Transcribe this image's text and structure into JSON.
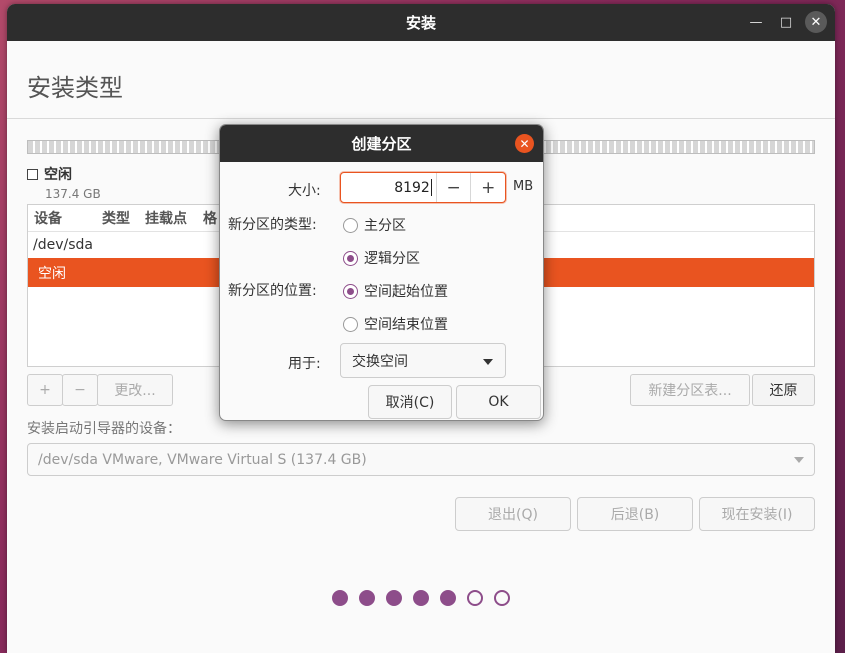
{
  "window": {
    "title": "安装"
  },
  "page": {
    "heading": "安装类型"
  },
  "disk_legend": {
    "name": "空闲",
    "size": "137.4 GB"
  },
  "table": {
    "columns": [
      "设备",
      "类型",
      "挂载点",
      "格"
    ],
    "rows": [
      "/dev/sda",
      "空闲"
    ]
  },
  "toolbar": {
    "add": "+",
    "remove": "−",
    "change": "更改...",
    "new_table": "新建分区表...",
    "revert": "还原"
  },
  "boot": {
    "label": "安装启动引导器的设备：",
    "value": "/dev/sda VMware, VMware Virtual S (137.4 GB)"
  },
  "nav": {
    "quit": "退出(Q)",
    "back": "后退(B)",
    "install": "现在安装(I)"
  },
  "progress": {
    "total_steps": 7,
    "completed_steps": 5
  },
  "dialog": {
    "title": "创建分区",
    "size_label": "大小:",
    "size_value": "8192",
    "unit": "MB",
    "minus": "−",
    "plus": "+",
    "type_label": "新分区的类型:",
    "type_primary": "主分区",
    "type_logical": "逻辑分区",
    "type_selected": "logical",
    "location_label": "新分区的位置:",
    "location_start": "空间起始位置",
    "location_end": "空间结束位置",
    "location_selected": "start",
    "use_label": "用于:",
    "use_value": "交换空间",
    "cancel": "取消(C)",
    "ok": "OK"
  },
  "colors": {
    "accent": "#e95420",
    "aubergine": "#8d4d8a",
    "titlebar": "#2d2d2d"
  }
}
